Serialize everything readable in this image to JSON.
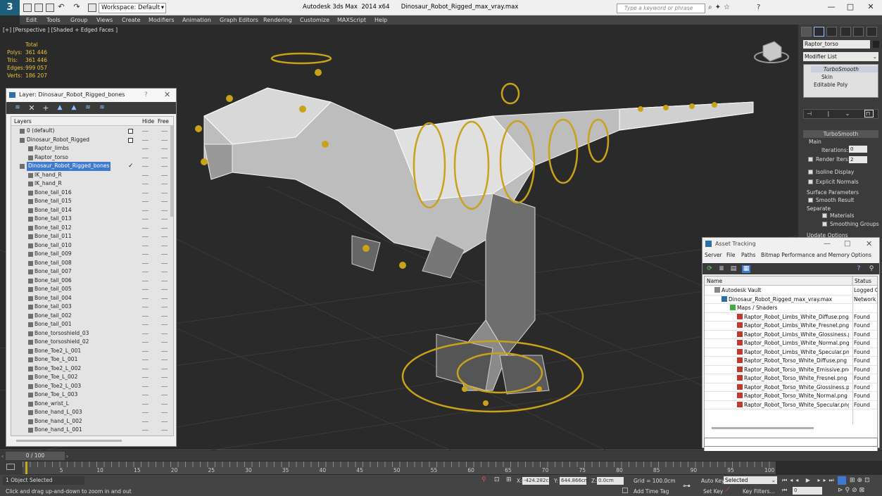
{
  "titlebar": {
    "workspace": "Workspace: Default",
    "app_title": "Autodesk 3ds Max  2014 x64      Dinosaur_Robot_Rigged_max_vray.max",
    "search_placeholder": "Type a keyword or phrase"
  },
  "menu": [
    "Edit",
    "Tools",
    "Group",
    "Views",
    "Create",
    "Modifiers",
    "Animation",
    "Graph Editors",
    "Rendering",
    "Customize",
    "MAXScript",
    "Help"
  ],
  "viewport": {
    "label": "[+] [Perspective ] [Shaded + Edged Faces ]",
    "stats": {
      "header": "Total",
      "rows": [
        {
          "k": "Polys:",
          "v": "361 446"
        },
        {
          "k": "Tris:",
          "v": "361 446"
        },
        {
          "k": "Edges:",
          "v": "999 057"
        },
        {
          "k": "Verts:",
          "v": "186 207"
        }
      ]
    }
  },
  "layer_dialog": {
    "title": "Layer: Dinosaur_Robot_Rigged_bones",
    "help": "?",
    "col_layers": "Layers",
    "col_hide": "Hide",
    "col_free": "Free",
    "rows": [
      {
        "name": "0 (default)",
        "indent": 0
      },
      {
        "name": "Dinosaur_Robot_Rigged",
        "indent": 0
      },
      {
        "name": "Raptor_limbs",
        "indent": 2
      },
      {
        "name": "Raptor_torso",
        "indent": 2
      },
      {
        "name": "Dinosaur_Robot_Rigged_bones",
        "indent": 0,
        "selected": true
      },
      {
        "name": "IK_hand_R",
        "indent": 2
      },
      {
        "name": "IK_hand_R",
        "indent": 2
      },
      {
        "name": "Bone_tail_016",
        "indent": 2
      },
      {
        "name": "Bone_tail_015",
        "indent": 2
      },
      {
        "name": "Bone_tail_014",
        "indent": 2
      },
      {
        "name": "Bone_tail_013",
        "indent": 2
      },
      {
        "name": "Bone_tail_012",
        "indent": 2
      },
      {
        "name": "Bone_tail_011",
        "indent": 2
      },
      {
        "name": "Bone_tail_010",
        "indent": 2
      },
      {
        "name": "Bone_tail_009",
        "indent": 2
      },
      {
        "name": "Bone_tail_008",
        "indent": 2
      },
      {
        "name": "Bone_tail_007",
        "indent": 2
      },
      {
        "name": "Bone_tail_006",
        "indent": 2
      },
      {
        "name": "Bone_tail_005",
        "indent": 2
      },
      {
        "name": "Bone_tail_004",
        "indent": 2
      },
      {
        "name": "Bone_tail_003",
        "indent": 2
      },
      {
        "name": "Bone_tail_002",
        "indent": 2
      },
      {
        "name": "Bone_tail_001",
        "indent": 2
      },
      {
        "name": "Bone_torsoshield_03",
        "indent": 2
      },
      {
        "name": "Bone_torsoshield_02",
        "indent": 2
      },
      {
        "name": "Bone_Toe2_L_001",
        "indent": 2
      },
      {
        "name": "Bone_Toe_L_001",
        "indent": 2
      },
      {
        "name": "Bone_Toe2_L_002",
        "indent": 2
      },
      {
        "name": "Bone_Toe_L_002",
        "indent": 2
      },
      {
        "name": "Bone_Toe2_L_003",
        "indent": 2
      },
      {
        "name": "Bone_Toe_L_003",
        "indent": 2
      },
      {
        "name": "Bone_wrist_L",
        "indent": 2
      },
      {
        "name": "Bone_hand_L_003",
        "indent": 2
      },
      {
        "name": "Bone_hand_L_002",
        "indent": 2
      },
      {
        "name": "Bone_hand_L_001",
        "indent": 2
      }
    ]
  },
  "command_panel": {
    "object_name": "Raptor_torso",
    "modifier_list": "Modifier List",
    "stack": [
      "TurboSmooth",
      "Skin",
      "Editable Poly"
    ],
    "rollout": "TurboSmooth",
    "group_main": "Main",
    "iterations_label": "Iterations:",
    "iterations_value": "0",
    "render_iters_label": "Render Iters:",
    "render_iters_value": "2",
    "isoline": "Isoline Display",
    "explicit": "Explicit Normals",
    "surface_params": "Surface Parameters",
    "smooth_result": "Smooth Result",
    "separate": "Separate",
    "materials": "Materials",
    "smoothing_groups": "Smoothing Groups",
    "update_options": "Update Options"
  },
  "asset_tracking": {
    "title": "Asset Tracking",
    "menu": [
      "Server",
      "File",
      "Paths",
      "Bitmap Performance and Memory",
      "Options"
    ],
    "col_name": "Name",
    "col_status": "Status",
    "rows": [
      {
        "name": "Autodesk Vault",
        "status": "Logged C",
        "indent": 14,
        "kind": "vault"
      },
      {
        "name": "Dinosaur_Robot_Rigged_max_vray.max",
        "status": "Network",
        "indent": 24,
        "kind": "max"
      },
      {
        "name": "Maps / Shaders",
        "status": "",
        "indent": 36,
        "kind": "folder"
      },
      {
        "name": "Raptor_Robot_Limbs_White_Diffuse.png",
        "status": "Found",
        "indent": 46,
        "kind": "png"
      },
      {
        "name": "Raptor_Robot_Limbs_White_Fresnel.png",
        "status": "Found",
        "indent": 46,
        "kind": "png"
      },
      {
        "name": "Raptor_Robot_Limbs_White_Glossiness.png",
        "status": "Found",
        "indent": 46,
        "kind": "png"
      },
      {
        "name": "Raptor_Robot_Limbs_White_Normal.png",
        "status": "Found",
        "indent": 46,
        "kind": "png"
      },
      {
        "name": "Raptor_Robot_Limbs_White_Specular.png",
        "status": "Found",
        "indent": 46,
        "kind": "png"
      },
      {
        "name": "Raptor_Robot_Torso_White_Diffuse.png",
        "status": "Found",
        "indent": 46,
        "kind": "png"
      },
      {
        "name": "Raptor_Robot_Torso_White_Emissive.png",
        "status": "Found",
        "indent": 46,
        "kind": "png"
      },
      {
        "name": "Raptor_Robot_Torso_White_Fresnel.png",
        "status": "Found",
        "indent": 46,
        "kind": "png"
      },
      {
        "name": "Raptor_Robot_Torso_White_Glossiness.png",
        "status": "Found",
        "indent": 46,
        "kind": "png"
      },
      {
        "name": "Raptor_Robot_Torso_White_Normal.png",
        "status": "Found",
        "indent": 46,
        "kind": "png"
      },
      {
        "name": "Raptor_Robot_Torso_White_Specular.png",
        "status": "Found",
        "indent": 46,
        "kind": "png"
      }
    ]
  },
  "timeline": {
    "slider": "0 / 100",
    "ticks": [
      "5",
      "10",
      "15",
      "20",
      "25",
      "30",
      "35",
      "40",
      "45",
      "50",
      "55",
      "60",
      "65",
      "70",
      "75",
      "80",
      "85",
      "90",
      "95",
      "100"
    ]
  },
  "status": {
    "selection": "1 Object Selected",
    "prompt": "Click and drag up-and-down to zoom in and out",
    "x_label": "X:",
    "x_value": "-424.282cr",
    "y_label": "Y:",
    "y_value": "644.866cm",
    "z_label": "Z:",
    "z_value": "0.0cm",
    "grid": "Grid = 100.0cm",
    "add_time_tag": "Add Time Tag",
    "auto_key": "Auto Key",
    "selected_dropdown": "Selected",
    "set_key": "Set Key",
    "key_filters": "Key Filters...",
    "frame_value": "0"
  },
  "colors": {
    "accent_yellow": "#e8c33a",
    "selection_blue": "#3f79d0",
    "viewport_bg": "#2a2a2a"
  }
}
